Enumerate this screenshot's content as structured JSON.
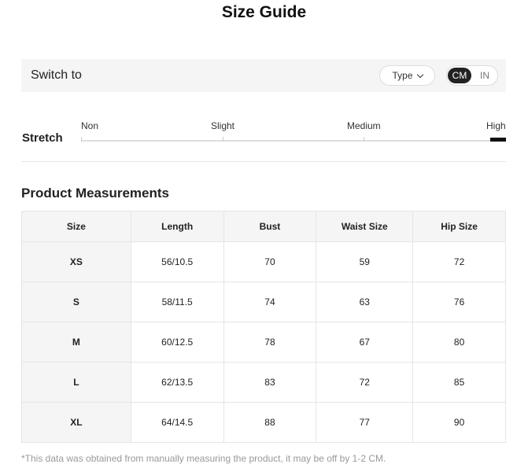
{
  "title": "Size Guide",
  "switch": {
    "label": "Switch to",
    "type_label": "Type",
    "units": [
      "CM",
      "IN"
    ],
    "selected_unit": "CM"
  },
  "stretch": {
    "label": "Stretch",
    "options": [
      "Non",
      "Slight",
      "Medium",
      "High"
    ],
    "selected": "High"
  },
  "measurements": {
    "title": "Product Measurements",
    "headers": [
      "Size",
      "Length",
      "Bust",
      "Waist Size",
      "Hip Size"
    ],
    "rows": [
      [
        "XS",
        "56/10.5",
        "70",
        "59",
        "72"
      ],
      [
        "S",
        "58/11.5",
        "74",
        "63",
        "76"
      ],
      [
        "M",
        "60/12.5",
        "78",
        "67",
        "80"
      ],
      [
        "L",
        "62/13.5",
        "83",
        "72",
        "85"
      ],
      [
        "XL",
        "64/14.5",
        "88",
        "77",
        "90"
      ]
    ]
  },
  "footnote": "*This data was obtained from manually measuring the product, it may be off by 1-2 CM."
}
